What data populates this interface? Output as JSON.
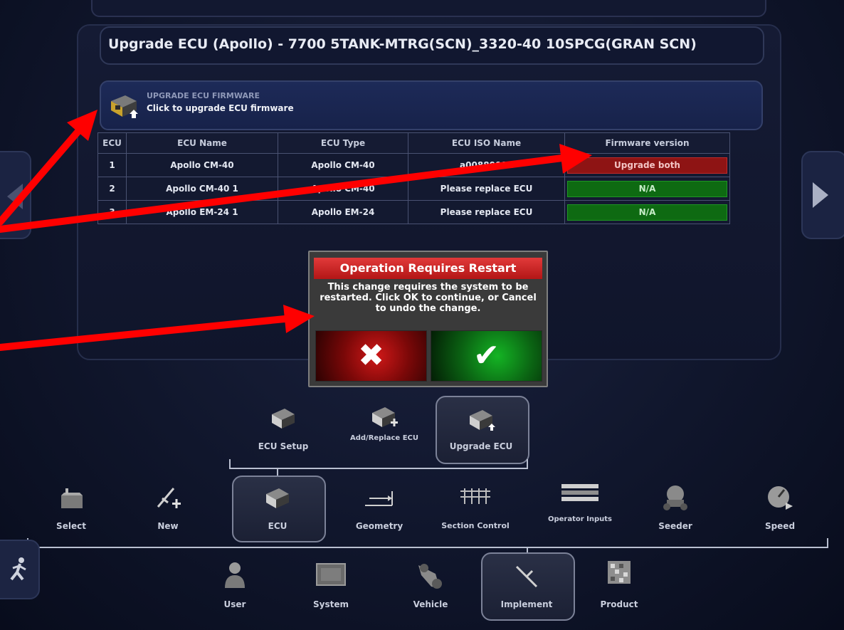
{
  "page": {
    "title": "Upgrade ECU (Apollo) - 7700 5TANK-MTRG(SCN)_3320-40 10SPCG(GRAN SCN)"
  },
  "upgrade_banner": {
    "heading": "UPGRADE ECU FIRMWARE",
    "subtitle": "Click to upgrade ECU firmware"
  },
  "ecu_table": {
    "headers": [
      "ECU",
      "ECU Name",
      "ECU Type",
      "ECU ISO Name",
      "Firmware version"
    ],
    "rows": [
      {
        "ecu": "1",
        "name": "Apollo CM-40",
        "type": "Apollo CM-40",
        "iso": "a00880081",
        "firmware": "Upgrade both",
        "status_color": "#8e1414"
      },
      {
        "ecu": "2",
        "name": "Apollo CM-40 1",
        "type": "Apollo CM-40",
        "iso": "Please replace ECU",
        "firmware": "N/A",
        "status_color": "#0e6a12"
      },
      {
        "ecu": "3",
        "name": "Apollo EM-24 1",
        "type": "Apollo EM-24",
        "iso": "Please replace ECU",
        "firmware": "N/A",
        "status_color": "#0e6a12"
      }
    ]
  },
  "dialog": {
    "title": "Operation Requires Restart",
    "message": "This change requires the system to be restarted. Click OK to continue, or Cancel to undo the change.",
    "cancel_symbol": "✖",
    "ok_symbol": "✔"
  },
  "ecu_subnav": {
    "items": [
      {
        "label": "ECU Setup",
        "icon": "ecu-setup-icon"
      },
      {
        "label": "Add/Replace ECU",
        "icon": "add-replace-ecu-icon"
      },
      {
        "label": "Upgrade ECU",
        "icon": "upgrade-ecu-icon",
        "selected": true
      }
    ]
  },
  "implement_nav": {
    "items": [
      {
        "label": "Select",
        "icon": "basket-icon"
      },
      {
        "label": "New",
        "icon": "new-implement-icon"
      },
      {
        "label": "ECU",
        "icon": "ecu-icon",
        "selected": true
      },
      {
        "label": "Geometry",
        "icon": "geometry-icon"
      },
      {
        "label": "Section Control",
        "icon": "section-control-icon"
      },
      {
        "label": "Operator Inputs",
        "icon": "operator-inputs-icon"
      },
      {
        "label": "Seeder",
        "icon": "seeder-icon"
      },
      {
        "label": "Speed",
        "icon": "speed-icon"
      }
    ]
  },
  "main_nav": {
    "items": [
      {
        "label": "User",
        "icon": "user-icon"
      },
      {
        "label": "System",
        "icon": "system-icon"
      },
      {
        "label": "Vehicle",
        "icon": "vehicle-icon"
      },
      {
        "label": "Implement",
        "icon": "implement-icon",
        "selected": true
      },
      {
        "label": "Product",
        "icon": "product-icon"
      }
    ]
  },
  "colors": {
    "annotation_arrow": "#ff0000",
    "dialog_title": "#d62828",
    "firmware_upgrade": "#8e1414",
    "firmware_na": "#0e6a12"
  }
}
